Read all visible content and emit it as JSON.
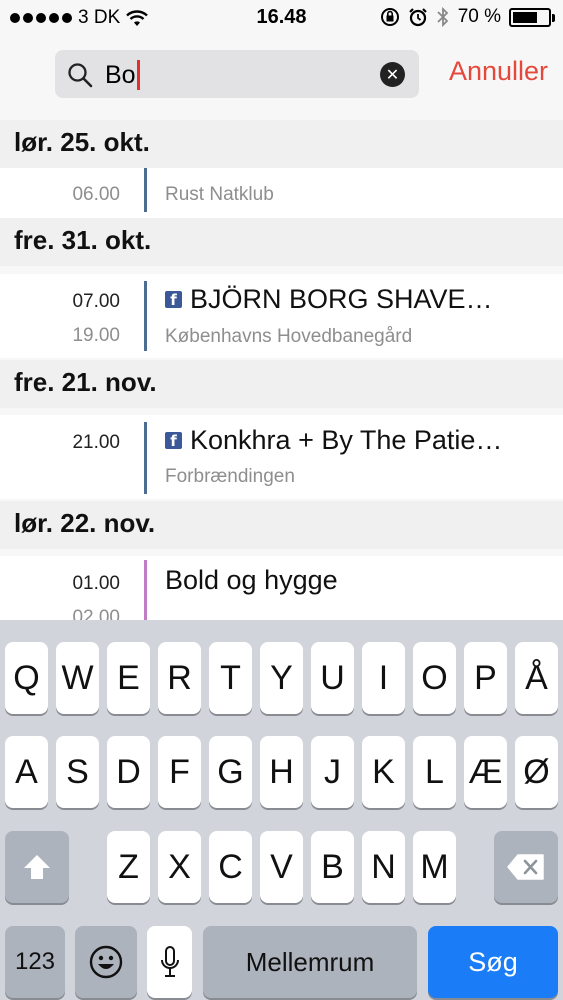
{
  "status_bar": {
    "carrier": "3 DK",
    "time": "16.48",
    "battery_text": "70 %",
    "battery_level": 0.7
  },
  "search": {
    "query": "Bo",
    "cancel_label": "Annuller"
  },
  "sections": [
    {
      "title": "lør. 25. okt.",
      "events": [
        {
          "time1": "",
          "time2": "06.00",
          "title": "",
          "venue": "Rust Natklub",
          "facebook": false
        }
      ]
    },
    {
      "title": "fre. 31. okt.",
      "events": [
        {
          "time1": "07.00",
          "time2": "19.00",
          "title": "BJÖRN BORG SHAVE…",
          "venue": "Københavns Hovedbanegård",
          "facebook": true
        }
      ]
    },
    {
      "title": "fre. 21. nov.",
      "events": [
        {
          "time1": "21.00",
          "time2": "",
          "title": "Konkhra + By The Patie…",
          "venue": "Forbrændingen",
          "facebook": true
        }
      ]
    },
    {
      "title": "lør. 22. nov.",
      "events": [
        {
          "time1": "01.00",
          "time2": "02.00",
          "title": "Bold og hygge",
          "venue": "",
          "facebook": false
        }
      ]
    }
  ],
  "keyboard": {
    "row1": [
      "Q",
      "W",
      "E",
      "R",
      "T",
      "Y",
      "U",
      "I",
      "O",
      "P",
      "Å"
    ],
    "row2": [
      "A",
      "S",
      "D",
      "F",
      "G",
      "H",
      "J",
      "K",
      "L",
      "Æ",
      "Ø"
    ],
    "row3": [
      "Z",
      "X",
      "C",
      "V",
      "B",
      "N",
      "M"
    ],
    "numbers_label": "123",
    "space_label": "Mellemrum",
    "search_label": "Søg"
  },
  "colors": {
    "accent_red": "#e5493b",
    "search_blue": "#1a7cf6",
    "event_bar": "#4b6e90",
    "event_bar_pink": "#c07dc6",
    "facebook": "#3b5998"
  }
}
